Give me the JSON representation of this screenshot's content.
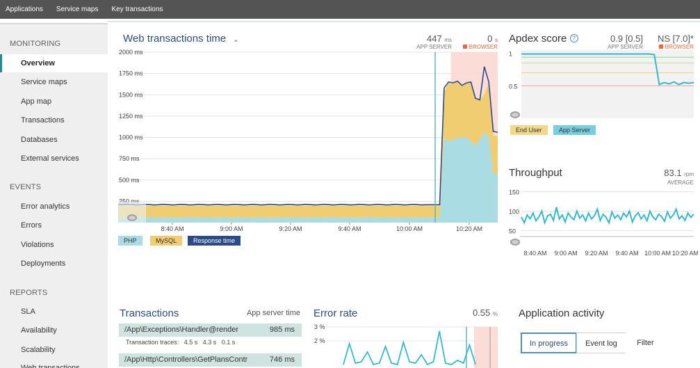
{
  "topnav": {
    "items": [
      "Applications",
      "Service maps",
      "Key transactions"
    ]
  },
  "sidebar": {
    "monitoring_heading": "MONITORING",
    "monitoring_items": [
      "Overview",
      "Service maps",
      "App map",
      "Transactions",
      "Databases",
      "External services"
    ],
    "events_heading": "EVENTS",
    "events_items": [
      "Error analytics",
      "Errors",
      "Violations",
      "Deployments"
    ],
    "reports_heading": "REPORTS",
    "reports_items": [
      "SLA",
      "Availability",
      "Scalability",
      "Web transactions"
    ]
  },
  "web_tx": {
    "title": "Web transactions time",
    "app_server_value": "447",
    "app_server_unit": "ms",
    "app_server_label": "APP SERVER",
    "browser_value": "0",
    "browser_unit": "s",
    "browser_label": "BROWSER",
    "legend": [
      "PHP",
      "MySQL",
      "Response time"
    ]
  },
  "apdex": {
    "title": "Apdex score",
    "help_icon": "question-circle-icon",
    "app_server_value": "0.9 [0.5]",
    "app_server_label": "APP SERVER",
    "browser_value": "NS [7.0]*",
    "browser_label": "BROWSER",
    "legend": [
      "End User",
      "App Server"
    ]
  },
  "throughput": {
    "title": "Throughput",
    "value": "83.1",
    "unit": "rpm",
    "sub": "AVERAGE"
  },
  "transactions": {
    "title": "Transactions",
    "right_label": "App server time",
    "rows": [
      {
        "name": "/App\\Exceptions\\Handler@render",
        "value": "985 ms",
        "traces_label": "Transaction traces:",
        "traces": [
          "4.5 s",
          "4.3 s",
          "0.1 s"
        ]
      },
      {
        "name": "/App\\Http\\Controllers\\GetPlansContr",
        "value": "746 ms"
      }
    ]
  },
  "error_rate": {
    "title": "Error rate",
    "value": "0.55",
    "unit": "%",
    "y_ticks": [
      "3 %",
      "2 %"
    ]
  },
  "activity": {
    "title": "Application activity",
    "buttons": [
      "In progress",
      "Event log",
      "Filter"
    ]
  },
  "colors": {
    "php": "#a9dde3",
    "mysql": "#f0cd70",
    "response": "#2b4a8b",
    "apdex_line": "#35b8d0",
    "browser_shade": "#f7c6bd",
    "deploy_line": "#5fb6c1"
  },
  "chart_data": [
    {
      "type": "area",
      "title": "Web transactions time",
      "ylabel": "",
      "ylim": [
        0,
        2000
      ],
      "y_ticks": [
        "2000 ms",
        "1750 ms",
        "1500 ms",
        "1250 ms",
        "1000 ms",
        "750 ms",
        "500 ms",
        "250 ms"
      ],
      "x_ticks": [
        "8:40 AM",
        "9:00 AM",
        "9:20 AM",
        "9:40 AM",
        "10:00 AM",
        "10:20 AM"
      ],
      "series": [
        {
          "name": "PHP",
          "values": [
            60,
            55,
            60,
            58,
            62,
            60,
            58,
            60,
            62,
            60,
            58,
            60,
            62,
            60,
            58,
            60,
            62,
            60,
            58,
            60,
            62,
            60,
            58,
            60,
            62,
            60,
            58,
            60,
            62,
            60,
            58,
            60,
            62,
            60,
            58,
            60,
            62,
            60,
            58,
            60,
            62,
            60,
            58,
            60,
            62,
            60,
            58,
            60,
            62,
            60,
            58,
            60,
            62,
            60,
            58,
            60,
            62,
            60,
            58,
            60,
            62,
            60,
            58,
            60,
            62,
            60,
            58,
            60,
            62,
            60,
            60,
            60,
            60,
            1000,
            950,
            980,
            990,
            1000,
            1000,
            960,
            900,
            980,
            1060,
            1010,
            580,
            560
          ]
        },
        {
          "name": "MySQL",
          "values": [
            140,
            145,
            140,
            142,
            138,
            140,
            142,
            140,
            138,
            140,
            142,
            140,
            138,
            140,
            142,
            140,
            138,
            140,
            142,
            140,
            138,
            140,
            142,
            140,
            138,
            140,
            142,
            140,
            138,
            140,
            142,
            140,
            138,
            140,
            142,
            140,
            138,
            140,
            142,
            140,
            138,
            140,
            142,
            140,
            138,
            140,
            142,
            140,
            138,
            140,
            142,
            140,
            138,
            140,
            142,
            140,
            138,
            140,
            142,
            140,
            138,
            140,
            142,
            140,
            138,
            140,
            142,
            140,
            138,
            140,
            140,
            140,
            140,
            540,
            690,
            650,
            660,
            600,
            630,
            680,
            560,
            450,
            450,
            630,
            440,
            460
          ]
        },
        {
          "name": "Response time",
          "values": [
            210,
            210,
            215,
            212,
            208,
            210,
            215,
            212,
            208,
            210,
            215,
            212,
            208,
            210,
            215,
            212,
            208,
            210,
            215,
            212,
            208,
            210,
            215,
            212,
            208,
            210,
            215,
            212,
            208,
            210,
            215,
            212,
            208,
            210,
            215,
            212,
            208,
            210,
            215,
            212,
            208,
            210,
            215,
            212,
            208,
            210,
            215,
            212,
            208,
            210,
            215,
            212,
            208,
            210,
            215,
            212,
            208,
            210,
            215,
            212,
            208,
            210,
            215,
            212,
            208,
            210,
            215,
            212,
            208,
            210,
            210,
            210,
            210,
            1580,
            1650,
            1640,
            1660,
            1610,
            1640,
            1650,
            1460,
            1440,
            1830,
            1650,
            1070,
            1060
          ]
        }
      ]
    },
    {
      "type": "line",
      "title": "Apdex score",
      "y_ticks": [
        "1",
        "0.5"
      ],
      "ylim": [
        0,
        1.05
      ],
      "series": [
        {
          "name": "App Server",
          "values": [
            0.99,
            0.99,
            0.99,
            0.99,
            0.99,
            0.99,
            0.99,
            0.99,
            0.99,
            0.99,
            0.99,
            0.99,
            0.99,
            0.99,
            0.99,
            0.99,
            0.99,
            0.99,
            0.99,
            0.99,
            0.99,
            0.99,
            0.99,
            0.99,
            0.99,
            0.99,
            0.99,
            0.98,
            0.52,
            0.55,
            0.53,
            0.56,
            0.52,
            0.55,
            0.54,
            0.55
          ]
        }
      ]
    },
    {
      "type": "line",
      "title": "Throughput",
      "y_ticks": [
        "150",
        "100",
        "50"
      ],
      "ylim": [
        40,
        160
      ],
      "x_ticks": [
        "8:40 AM",
        "9:00 AM",
        "9:20 AM",
        "9:40 AM",
        "10:00 AM",
        "10:20 AM"
      ],
      "series": [
        {
          "name": "Throughput",
          "values": [
            85,
            70,
            90,
            80,
            95,
            75,
            85,
            100,
            70,
            88,
            92,
            76,
            110,
            80,
            90,
            72,
            95,
            85,
            78,
            100,
            82,
            90,
            75,
            95,
            80,
            88,
            105,
            76,
            92,
            84,
            70,
            98,
            82,
            90,
            78,
            95,
            85,
            100,
            72,
            88,
            96,
            80,
            90,
            75,
            100,
            85,
            78,
            92,
            86,
            74,
            98,
            82,
            90,
            105,
            80,
            88,
            76,
            95,
            84,
            92
          ]
        }
      ]
    },
    {
      "type": "line",
      "title": "Error rate",
      "y_ticks": [
        "3 %",
        "2 %"
      ],
      "series": [
        {
          "name": "Error rate",
          "values": [
            0.3,
            1.8,
            0.4,
            0.5,
            1.2,
            0.3,
            0.4,
            1.6,
            0.4,
            0.3,
            1.9,
            0.5,
            0.4,
            1.0,
            0.3,
            0.5,
            2.7,
            0.4,
            0.3,
            0.6,
            0.4,
            1.7,
            0.3
          ]
        }
      ]
    }
  ]
}
